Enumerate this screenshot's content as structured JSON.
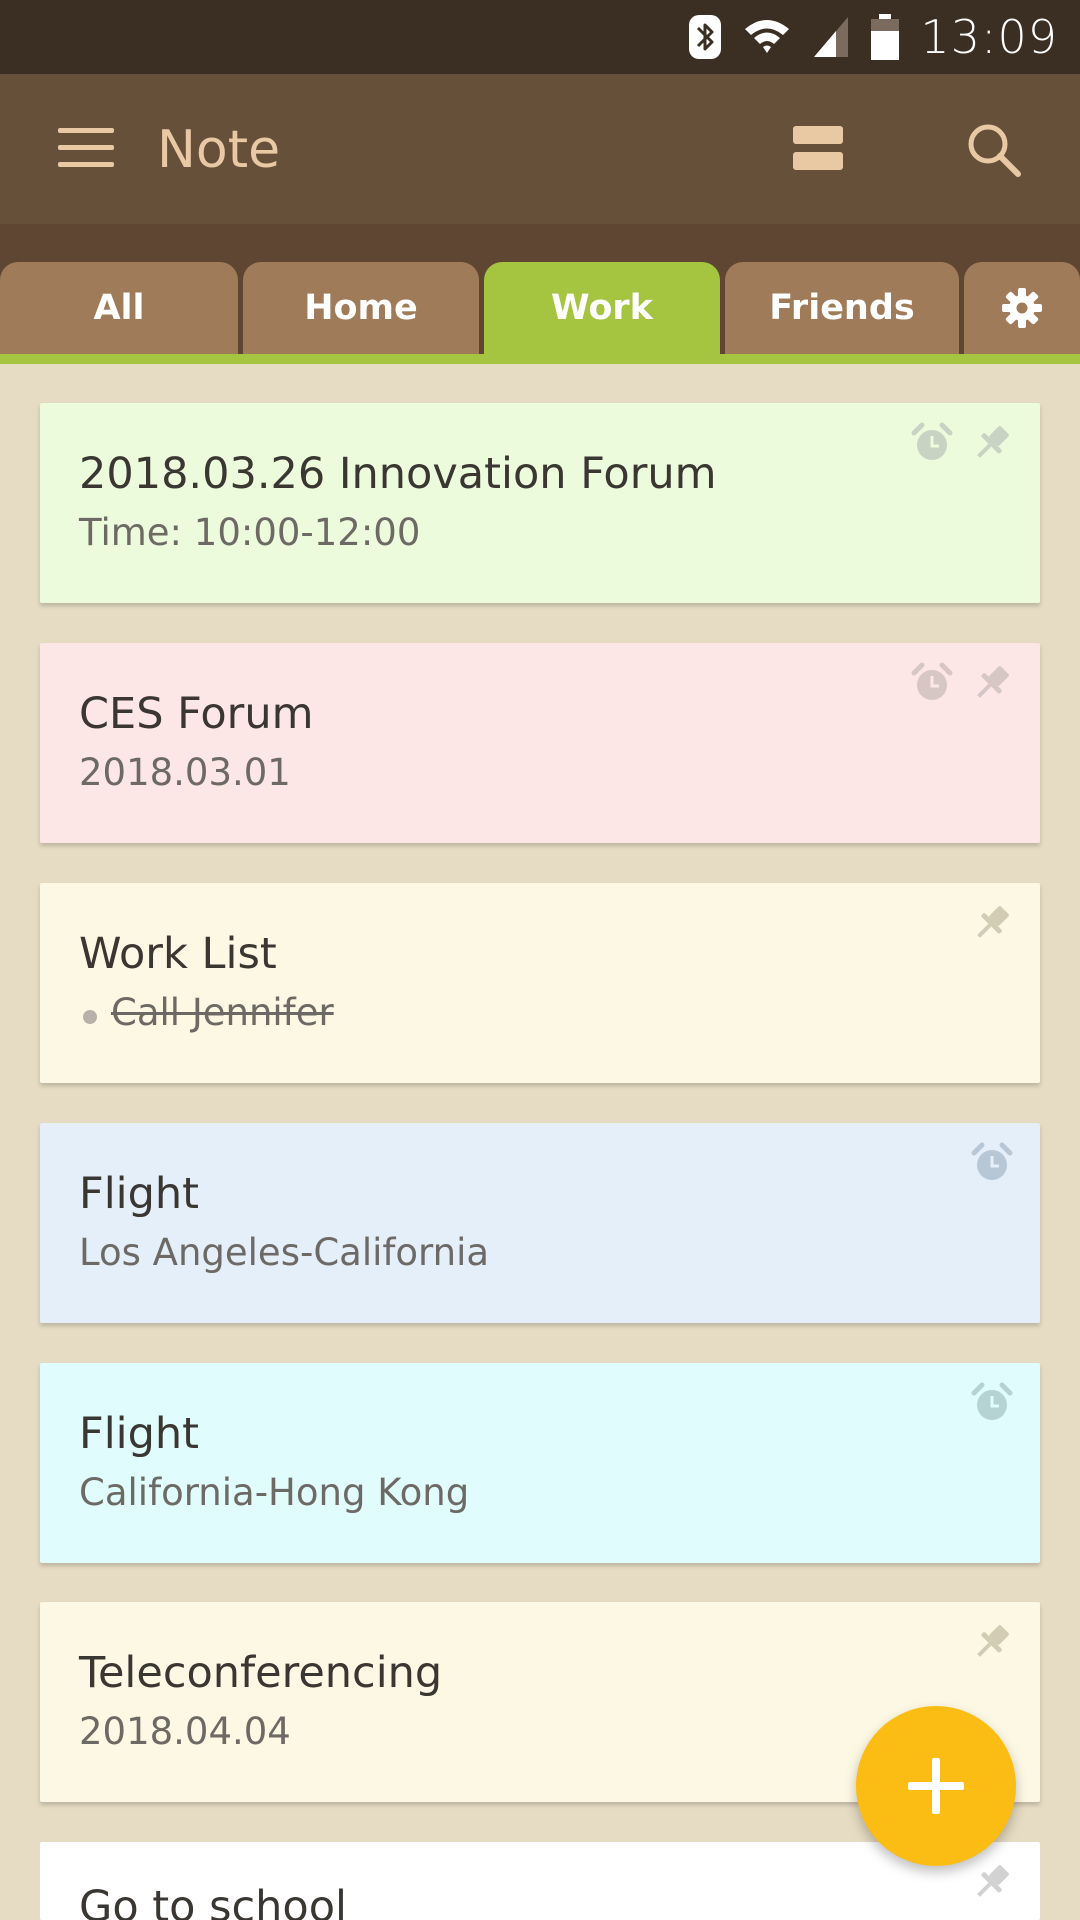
{
  "status_bar": {
    "time": "13:09",
    "icons": [
      "bluetooth-icon",
      "wifi-icon",
      "cellular-signal-icon",
      "battery-icon"
    ]
  },
  "app_bar": {
    "title": "Note",
    "menu_icon": "hamburger-menu-icon",
    "view_icon": "view-toggle-icon",
    "search_icon": "search-icon"
  },
  "tabs": [
    {
      "label": "All",
      "active": false
    },
    {
      "label": "Home",
      "active": false
    },
    {
      "label": "Work",
      "active": true
    },
    {
      "label": "Friends",
      "active": false
    },
    {
      "label": "",
      "icon": "gear-icon"
    }
  ],
  "notes": [
    {
      "title": "2018.03.26   Innovation Forum",
      "subtitle": "Time: 10:00-12:00",
      "color": "#ecfbdb",
      "alarm": true,
      "pin": true
    },
    {
      "title": "CES Forum",
      "subtitle": "2018.03.01",
      "color": "#fde7e6",
      "alarm": true,
      "pin": true
    },
    {
      "title": "Work List",
      "subtitle": "Call Jennifer",
      "subtitle_struck": true,
      "color": "#fdf8e3",
      "alarm": false,
      "pin": true
    },
    {
      "title": "Flight",
      "subtitle": "Los Angeles-California",
      "color": "#e4effa",
      "alarm": true,
      "pin": false
    },
    {
      "title": "Flight",
      "subtitle": "California-Hong Kong",
      "color": "#e0fcfc",
      "alarm": true,
      "pin": false
    },
    {
      "title": "Teleconferencing",
      "subtitle": "2018.04.04",
      "color": "#fdf8e3",
      "alarm": false,
      "pin": true
    },
    {
      "title": "Go to school",
      "subtitle": "",
      "color": "#ffffff",
      "alarm": false,
      "pin": true
    }
  ],
  "fab": {
    "icon": "add-icon"
  },
  "colors": {
    "status_bar": "#3b2e22",
    "app_bar": "#67503a",
    "tab": "#a07b5a",
    "tab_active": "#a5c440",
    "background": "#e6dcc3",
    "fab": "#fbbc13"
  }
}
